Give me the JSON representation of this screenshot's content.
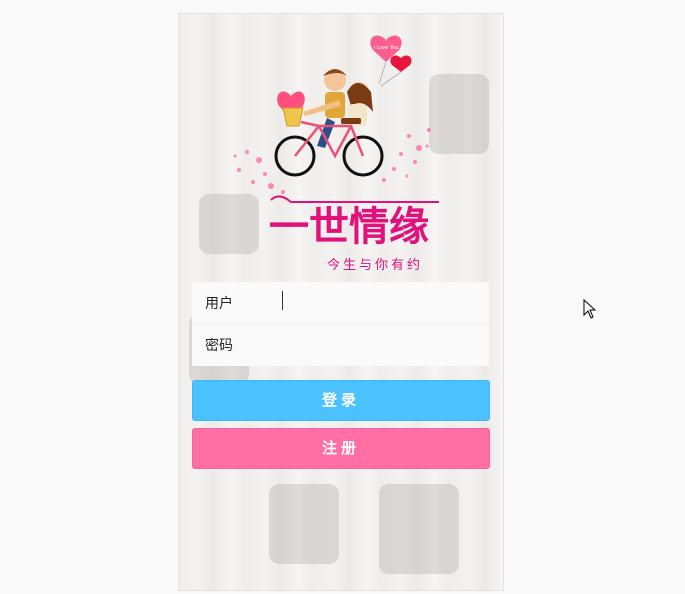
{
  "app": {
    "logo_title": "一世情缘",
    "logo_subtitle": "今生与你有约",
    "balloon_text": "I Love You"
  },
  "form": {
    "username_label": "用户",
    "username_value": "",
    "password_label": "密码",
    "password_value": ""
  },
  "buttons": {
    "login_label": "登录",
    "register_label": "注册"
  },
  "colors": {
    "login": "#4cc1ff",
    "register": "#ff6fa3",
    "brand": "#e0117a"
  }
}
